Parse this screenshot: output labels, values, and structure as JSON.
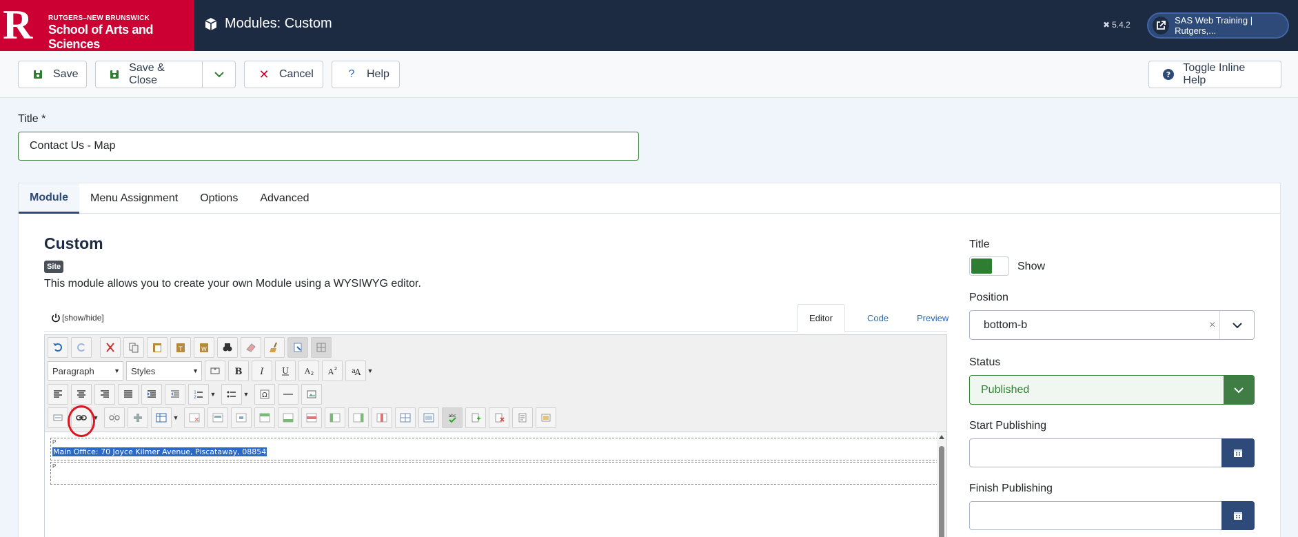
{
  "header": {
    "brand_top": "RUTGERS–NEW BRUNSWICK",
    "brand_main": "School of Arts and Sciences",
    "brand_letter": "R",
    "page_title": "Modules: Custom",
    "version": "5.4.2",
    "site_link": "SAS Web Training | Rutgers,..."
  },
  "toolbar": {
    "save": "Save",
    "save_close": "Save & Close",
    "cancel": "Cancel",
    "help": "Help",
    "toggle_help": "Toggle Inline Help"
  },
  "form": {
    "title_label": "Title *",
    "title_value": "Contact Us - Map"
  },
  "tabs": [
    "Module",
    "Menu Assignment",
    "Options",
    "Advanced"
  ],
  "module": {
    "name": "Custom",
    "badge": "Site",
    "description": "This module allows you to create your own Module using a WYSIWYG editor."
  },
  "editor": {
    "show_hide": "[show/hide]",
    "tabs": [
      "Editor",
      "Code",
      "Preview"
    ],
    "format_select": "Paragraph",
    "styles_select": "Styles",
    "p_tag": "P",
    "selected_text": "Main Office: 70 Joyce Kilmer Avenue, Piscataway, 08854"
  },
  "sidebar": {
    "title_label": "Title",
    "title_toggle": "Show",
    "position_label": "Position",
    "position_value": "bottom-b",
    "clear_symbol": "×",
    "status_label": "Status",
    "status_value": "Published",
    "start_label": "Start Publishing",
    "finish_label": "Finish Publishing"
  },
  "colors": {
    "brand_red": "#cc0033",
    "header_navy": "#1c2a42",
    "accent_blue": "#2d4a79",
    "published_green": "#2f7d32"
  }
}
